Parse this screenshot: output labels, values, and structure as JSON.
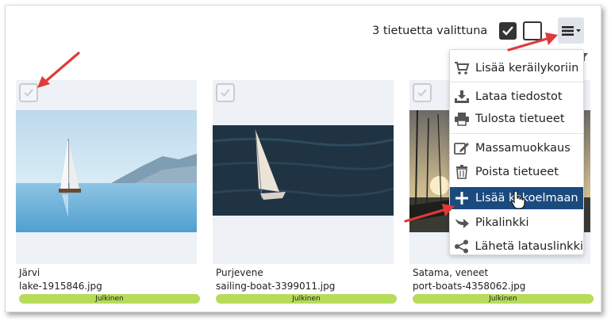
{
  "toolbar": {
    "selection_text": "3 tietuetta valittuna"
  },
  "cards": [
    {
      "title": "Järvi",
      "filename": "lake-1915846.jpg",
      "status": "Julkinen"
    },
    {
      "title": "Purjevene",
      "filename": "sailing-boat-3399011.jpg",
      "status": "Julkinen"
    },
    {
      "title": "Satama, veneet",
      "filename": "port-boats-4358062.jpg",
      "status": "Julkinen"
    }
  ],
  "menu": {
    "items": [
      {
        "label": "Lisää keräilykoriin",
        "icon": "cart-icon"
      },
      {
        "label": "Lataa tiedostot",
        "icon": "download-icon"
      },
      {
        "label": "Tulosta tietueet",
        "icon": "print-icon"
      },
      {
        "label": "Massamuokkaus",
        "icon": "edit-icon"
      },
      {
        "label": "Poista tietueet",
        "icon": "trash-icon"
      },
      {
        "label": "Lisää kokoelmaan",
        "icon": "plus-icon"
      },
      {
        "label": "Pikalinkki",
        "icon": "share-arrow-icon"
      },
      {
        "label": "Lähetä latauslinkki",
        "icon": "share-icon"
      }
    ]
  },
  "colors": {
    "active_item": "#1b4a7e",
    "status_badge": "#b6dc5a",
    "annotation_arrow": "#e03a3a"
  }
}
